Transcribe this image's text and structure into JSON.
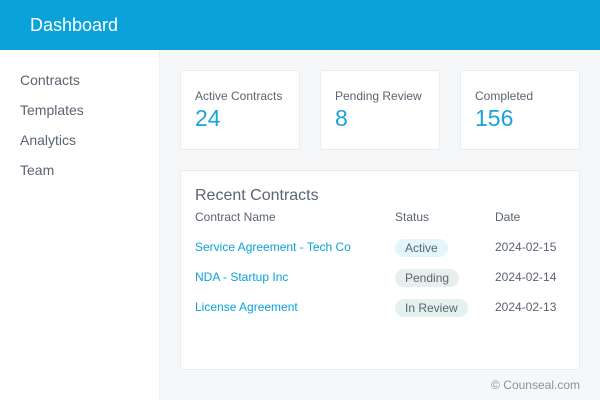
{
  "header": {
    "title": "Dashboard"
  },
  "sidebar": {
    "items": [
      {
        "label": "Contracts"
      },
      {
        "label": "Templates"
      },
      {
        "label": "Analytics"
      },
      {
        "label": "Team"
      }
    ]
  },
  "stats": [
    {
      "label": "Active Contracts",
      "value": "24"
    },
    {
      "label": "Pending Review",
      "value": "8"
    },
    {
      "label": "Completed",
      "value": "156"
    }
  ],
  "recent": {
    "title": "Recent Contracts",
    "columns": {
      "name": "Contract Name",
      "status": "Status",
      "date": "Date"
    },
    "rows": [
      {
        "name": "Service Agreement - Tech Co",
        "status": "Active",
        "date": "2024-02-15"
      },
      {
        "name": "NDA - Startup Inc",
        "status": "Pending",
        "date": "2024-02-14"
      },
      {
        "name": "License Agreement",
        "status": "In Review",
        "date": "2024-02-13"
      }
    ]
  },
  "footer": {
    "text": "© Counseal.com"
  },
  "colors": {
    "header_bg": "#0aa2d8",
    "accent": "#1aa3db",
    "badge_active": "#e3f6fb",
    "badge_pending": "#e7efee",
    "badge_review": "#e4f2ef"
  }
}
